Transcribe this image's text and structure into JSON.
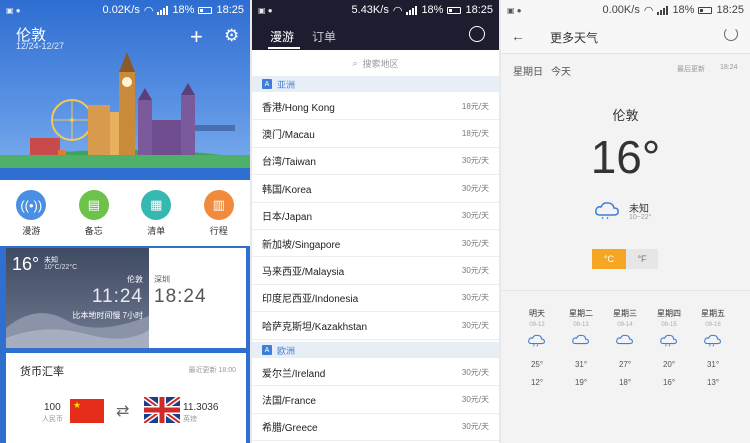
{
  "panel1": {
    "status": {
      "speed": "0.02K/s",
      "battery": "18%",
      "time": "18:25"
    },
    "city": "伦敦",
    "dates": "12/24-12/27",
    "quick": [
      {
        "label": "漫游",
        "color": "#4a90e2",
        "icon": "wifi-icon"
      },
      {
        "label": "备忘",
        "color": "#6cc24a",
        "icon": "memo-icon"
      },
      {
        "label": "清单",
        "color": "#35b8b0",
        "icon": "clipboard-icon"
      },
      {
        "label": "行程",
        "color": "#f08a3c",
        "icon": "calendar-icon"
      }
    ],
    "weather": {
      "temp": "16°",
      "desc": "未知",
      "range": "10°C/22°C",
      "city": "伦敦",
      "time": "11:24",
      "note": "比本地时间慢 7小时",
      "home_city": "深圳",
      "home_time": "18:24"
    },
    "fx": {
      "title": "货币汇率",
      "updated": "最近更新 18:00",
      "from_amount": "100",
      "from_currency": "人民币",
      "to_amount": "11.3036",
      "to_currency": "英镑"
    }
  },
  "panel2": {
    "status": {
      "speed": "5.43K/s",
      "battery": "18%",
      "time": "18:25"
    },
    "tabs": [
      "漫游",
      "订单"
    ],
    "search_placeholder": "搜索地区",
    "sections": [
      {
        "name": "亚洲",
        "icon": "A",
        "rows": [
          {
            "name": "香港/Hong Kong",
            "price": "18元/天"
          },
          {
            "name": "澳门/Macau",
            "price": "18元/天"
          },
          {
            "name": "台湾/Taiwan",
            "price": "30元/天"
          },
          {
            "name": "韩国/Korea",
            "price": "30元/天"
          },
          {
            "name": "日本/Japan",
            "price": "30元/天"
          },
          {
            "name": "新加坡/Singapore",
            "price": "30元/天"
          },
          {
            "name": "马来西亚/Malaysia",
            "price": "30元/天"
          },
          {
            "name": "印度尼西亚/Indonesia",
            "price": "30元/天"
          },
          {
            "name": "哈萨克斯坦/Kazakhstan",
            "price": "30元/天"
          }
        ]
      },
      {
        "name": "欧洲",
        "icon": "A",
        "rows": [
          {
            "name": "爱尔兰/Ireland",
            "price": "30元/天"
          },
          {
            "name": "法国/France",
            "price": "30元/天"
          },
          {
            "name": "希腊/Greece",
            "price": "30元/天"
          }
        ]
      }
    ]
  },
  "panel3": {
    "status": {
      "speed": "0.00K/s",
      "battery": "18%",
      "time": "18:25"
    },
    "title": "更多天气",
    "day": "星期日",
    "today": "今天",
    "updated_label": "最后更新",
    "updated_time": "18:24",
    "city": "伦敦",
    "temp": "16°",
    "condition": "未知",
    "range": "10~22°",
    "units": [
      "°C",
      "°F"
    ],
    "forecast": [
      {
        "day": "明天",
        "date": "09-12",
        "hi": "25°",
        "lo": "12°",
        "icon": "rain-cloud-icon"
      },
      {
        "day": "星期二",
        "date": "09-13",
        "hi": "31°",
        "lo": "19°",
        "icon": "cloud-icon"
      },
      {
        "day": "星期三",
        "date": "09-14",
        "hi": "27°",
        "lo": "18°",
        "icon": "cloud-icon"
      },
      {
        "day": "星期四",
        "date": "09-15",
        "hi": "20°",
        "lo": "16°",
        "icon": "rain-cloud-icon"
      },
      {
        "day": "星期五",
        "date": "09-16",
        "hi": "31°",
        "lo": "13°",
        "icon": "storm-cloud-icon"
      }
    ]
  }
}
